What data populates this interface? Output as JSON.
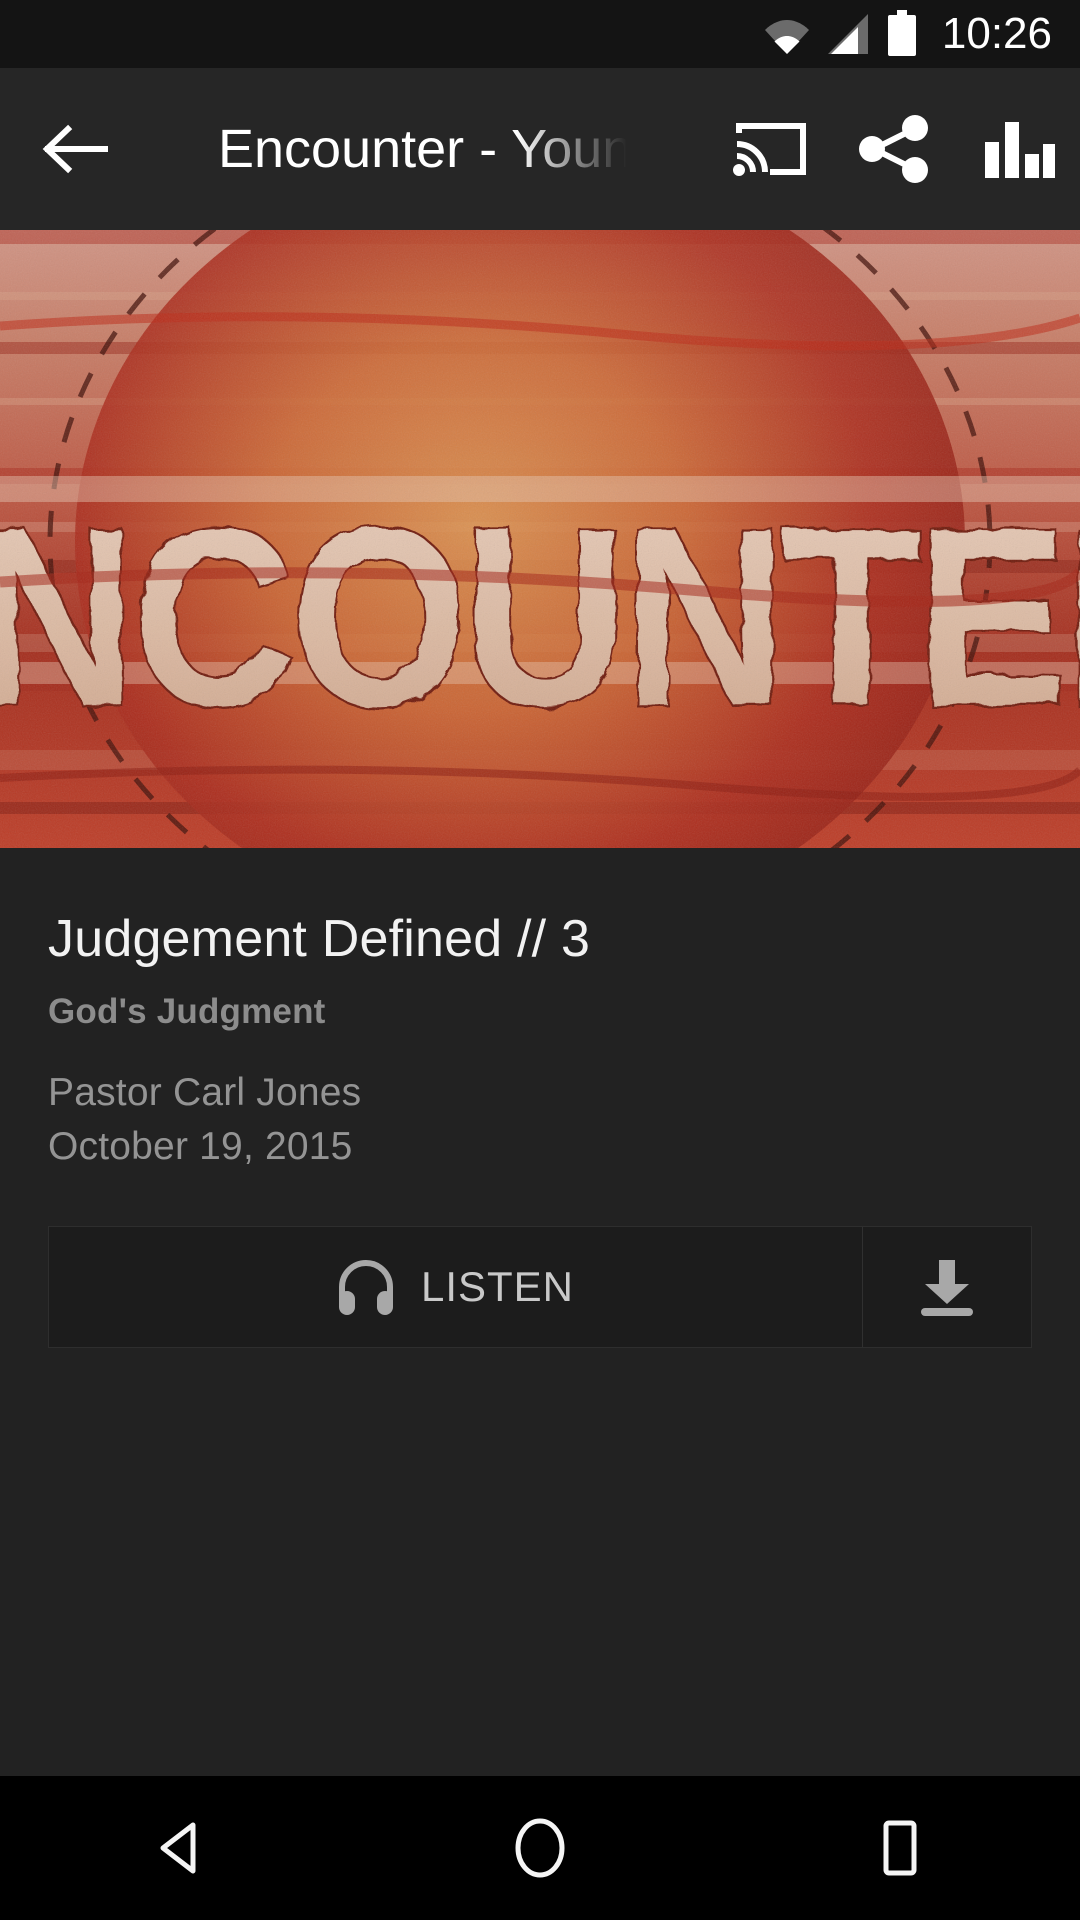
{
  "statusbar": {
    "time": "10:26",
    "icons": [
      "wifi-icon",
      "cellular-signal-icon",
      "battery-icon"
    ]
  },
  "appbar": {
    "back_icon": "arrow-back-icon",
    "title": "Encounter - Youn",
    "actions": [
      {
        "name": "cast-icon",
        "label": "Cast"
      },
      {
        "name": "share-icon",
        "label": "Share"
      },
      {
        "name": "equalizer-icon",
        "label": "Equalizer"
      }
    ]
  },
  "banner": {
    "artwork_text": "ENCOUNTER",
    "colors": {
      "base": "#b8402c",
      "wood_light": "#e8c89a",
      "wood_mid": "#d88a4a",
      "red_deep": "#8f1f18",
      "red_bright": "#d23b22",
      "pink_wash": "#d99a96"
    }
  },
  "sermon": {
    "title": "Judgement Defined // 3",
    "series": "God's Judgment",
    "speaker": "Pastor Carl Jones",
    "date": "October 19, 2015"
  },
  "actions": {
    "listen_label": "LISTEN",
    "listen_icon": "headphones-icon",
    "download_icon": "download-icon"
  },
  "navbar": {
    "back": "nav-back-icon",
    "home": "nav-home-icon",
    "recents": "nav-recents-icon"
  }
}
